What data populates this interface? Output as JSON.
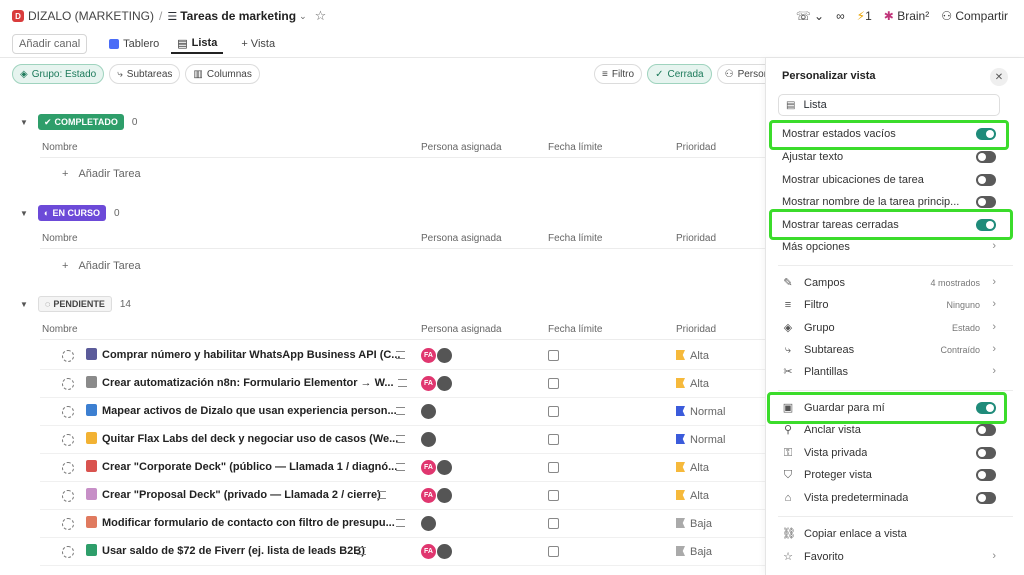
{
  "header": {
    "workspace_badge": "D",
    "workspace": "DIZALO (MARKETING)",
    "separator": "/",
    "list_title": "Tareas de marketing",
    "brain_label": "Brain²",
    "share_label": "Compartir",
    "counter": "1"
  },
  "viewbar": {
    "add_channel": "Añadir canal",
    "tab_board": "Tablero",
    "tab_list": "Lista",
    "add_view": "+ Vista"
  },
  "filters": {
    "group": "Grupo: Estado",
    "subtasks": "Subtareas",
    "columns": "Columnas",
    "filter": "Filtro",
    "closed": "Cerrada",
    "assignee": "Persona a"
  },
  "columns": {
    "name": "Nombre",
    "assignee": "Persona asignada",
    "due": "Fecha límite",
    "priority": "Prioridad"
  },
  "add_task": "Añadir Tarea",
  "groups": [
    {
      "label": "COMPLETADO",
      "count": "0"
    },
    {
      "label": "EN CURSO",
      "count": "0"
    },
    {
      "label": "PENDIENTE",
      "count": "14"
    }
  ],
  "tasks": [
    {
      "name": "Comprar número y habilitar WhatsApp Business API (C...",
      "fa": "FA",
      "priority": "Alta"
    },
    {
      "name": "Crear automatización n8n: Formulario Elementor → W...",
      "fa": "FA",
      "priority": "Alta"
    },
    {
      "name": "Mapear activos de Dizalo que usan experiencia person...",
      "fa": "",
      "priority": "Normal"
    },
    {
      "name": "Quitar Flax Labs del deck y negociar uso de casos (We...",
      "fa": "",
      "priority": "Normal"
    },
    {
      "name": "Crear \"Corporate Deck\" (público — Llamada 1 / diagnó...",
      "fa": "FA",
      "priority": "Alta"
    },
    {
      "name": "Crear \"Proposal Deck\" (privado — Llamada 2 / cierre)",
      "fa": "FA",
      "priority": "Alta"
    },
    {
      "name": "Modificar formulario de contacto con filtro de presupu...",
      "fa": "",
      "priority": "Baja"
    },
    {
      "name": "Usar saldo de $72 de Fiverr (ej. lista de leads B2B)",
      "fa": "FA",
      "priority": "Baja"
    }
  ],
  "colors": {
    "high": "#f6b93b",
    "normal": "#3b5bdb",
    "low": "#aaaaaa",
    "toggle_on": "#1f8b7a",
    "highlight": "#3bdc2b"
  },
  "panel": {
    "title": "Personalizar vista",
    "view_name": "Lista",
    "options": [
      {
        "label": "Mostrar estados vacíos",
        "on": true
      },
      {
        "label": "Ajustar texto",
        "on": false
      },
      {
        "label": "Mostrar ubicaciones de tarea",
        "on": false
      },
      {
        "label": "Mostrar nombre de la tarea princip...",
        "on": false
      },
      {
        "label": "Mostrar tareas cerradas",
        "on": true
      }
    ],
    "more_options": "Más opciones",
    "settings": [
      {
        "label": "Campos",
        "value": "4 mostrados"
      },
      {
        "label": "Filtro",
        "value": "Ninguno"
      },
      {
        "label": "Grupo",
        "value": "Estado"
      },
      {
        "label": "Subtareas",
        "value": "Contraído"
      },
      {
        "label": "Plantillas",
        "value": ""
      }
    ],
    "toggles2": [
      {
        "label": "Guardar para mí",
        "on": true
      },
      {
        "label": "Anclar vista",
        "on": false
      },
      {
        "label": "Vista privada",
        "on": false
      },
      {
        "label": "Proteger vista",
        "on": false
      },
      {
        "label": "Vista predeterminada",
        "on": false
      }
    ],
    "copy_link": "Copiar enlace a vista",
    "favorite": "Favorito"
  }
}
